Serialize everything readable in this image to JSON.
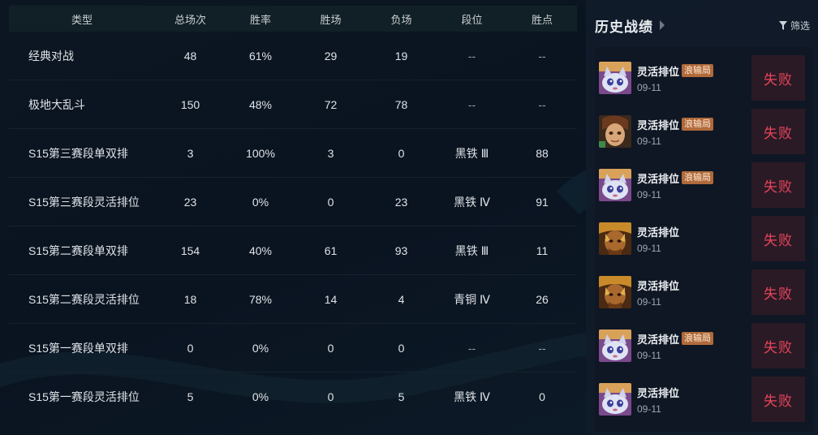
{
  "stats": {
    "headers": {
      "type": "类型",
      "total": "总场次",
      "rate": "胜率",
      "wins": "胜场",
      "losses": "负场",
      "tier": "段位",
      "lp": "胜点"
    },
    "rows": [
      {
        "type": "经典对战",
        "total": "48",
        "rate": "61%",
        "wins": "29",
        "losses": "19",
        "tier": "--",
        "lp": "--"
      },
      {
        "type": "极地大乱斗",
        "total": "150",
        "rate": "48%",
        "wins": "72",
        "losses": "78",
        "tier": "--",
        "lp": "--"
      },
      {
        "type": "S15第三赛段单双排",
        "total": "3",
        "rate": "100%",
        "wins": "3",
        "losses": "0",
        "tier": "黑铁 Ⅲ",
        "lp": "88"
      },
      {
        "type": "S15第三赛段灵活排位",
        "total": "23",
        "rate": "0%",
        "wins": "0",
        "losses": "23",
        "tier": "黑铁 Ⅳ",
        "lp": "91"
      },
      {
        "type": "S15第二赛段单双排",
        "total": "154",
        "rate": "40%",
        "wins": "61",
        "losses": "93",
        "tier": "黑铁 Ⅲ",
        "lp": "11"
      },
      {
        "type": "S15第二赛段灵活排位",
        "total": "18",
        "rate": "78%",
        "wins": "14",
        "losses": "4",
        "tier": "青铜 Ⅳ",
        "lp": "26"
      },
      {
        "type": "S15第一赛段单双排",
        "total": "0",
        "rate": "0%",
        "wins": "0",
        "losses": "0",
        "tier": "--",
        "lp": "--"
      },
      {
        "type": "S15第一赛段灵活排位",
        "total": "5",
        "rate": "0%",
        "wins": "0",
        "losses": "5",
        "tier": "黑铁 Ⅳ",
        "lp": "0"
      }
    ]
  },
  "history": {
    "title": "历史战绩",
    "filter_label": "筛选",
    "matches": [
      {
        "mode": "灵活排位",
        "tag": "浪输局",
        "date": "09-11",
        "result": "失败",
        "avatar": "yuumi-cat-icon"
      },
      {
        "mode": "灵活排位",
        "tag": "浪输局",
        "date": "09-11",
        "result": "失败",
        "avatar": "champion-boy-icon"
      },
      {
        "mode": "灵活排位",
        "tag": "浪输局",
        "date": "09-11",
        "result": "失败",
        "avatar": "yuumi-cat-icon"
      },
      {
        "mode": "灵活排位",
        "tag": "",
        "date": "09-11",
        "result": "失败",
        "avatar": "champion-warrior-icon"
      },
      {
        "mode": "灵活排位",
        "tag": "",
        "date": "09-11",
        "result": "失败",
        "avatar": "champion-warrior-icon"
      },
      {
        "mode": "灵活排位",
        "tag": "浪输局",
        "date": "09-11",
        "result": "失败",
        "avatar": "yuumi-cat-icon"
      },
      {
        "mode": "灵活排位",
        "tag": "",
        "date": "09-11",
        "result": "失败",
        "avatar": "yuumi-cat-icon"
      }
    ]
  },
  "colors": {
    "loss": "#e8445a",
    "tag_bg": "#b06a3a"
  }
}
